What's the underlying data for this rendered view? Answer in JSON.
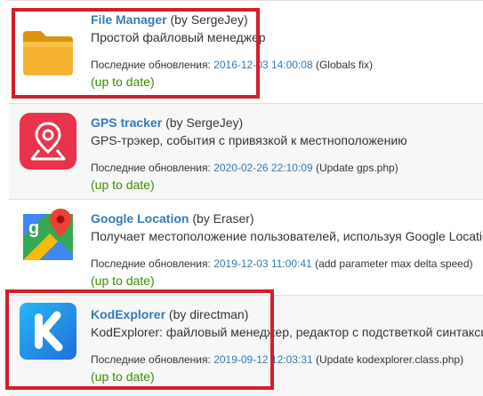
{
  "plugins": [
    {
      "name": "File Manager",
      "author": "(by SergeJey)",
      "description": "Простой файловый менеджер",
      "updated_label": "Последние обновления:",
      "updated_date": "2016-12-03 14:00:08",
      "updated_note": "(Globals fix)",
      "status": "(up to date)",
      "icon": "folder-icon"
    },
    {
      "name": "GPS tracker",
      "author": "(by SergeJey)",
      "description": "GPS-трэкер, события с привязкой к местноположению",
      "updated_label": "Последние обновления:",
      "updated_date": "2020-02-26 22:10:09",
      "updated_note": "(Update gps.php)",
      "status": "(up to date)",
      "icon": "map-pin-icon"
    },
    {
      "name": "Google Location",
      "author": "(by Eraser)",
      "description": "Получает местоположение пользователей, используя Google Location",
      "updated_label": "Последние обновления:",
      "updated_date": "2019-12-03 11:00:41",
      "updated_note": "(add parameter max delta speed)",
      "status": "(up to date)",
      "icon": "google-maps-icon"
    },
    {
      "name": "KodExplorer",
      "author": "(by directman)",
      "description": "KodExplorer: файловый менеджер, редактор с подстветкой синтаксиса",
      "updated_label": "Последние обновления:",
      "updated_date": "2019-09-12 12:03:31",
      "updated_note": "(Update kodexplorer.class.php)",
      "status": "(up to date)",
      "icon": "kodexplorer-k-icon"
    }
  ],
  "colors": {
    "link": "#337ab7",
    "status_ok": "#3c8c00",
    "highlight": "#d21f2b"
  }
}
